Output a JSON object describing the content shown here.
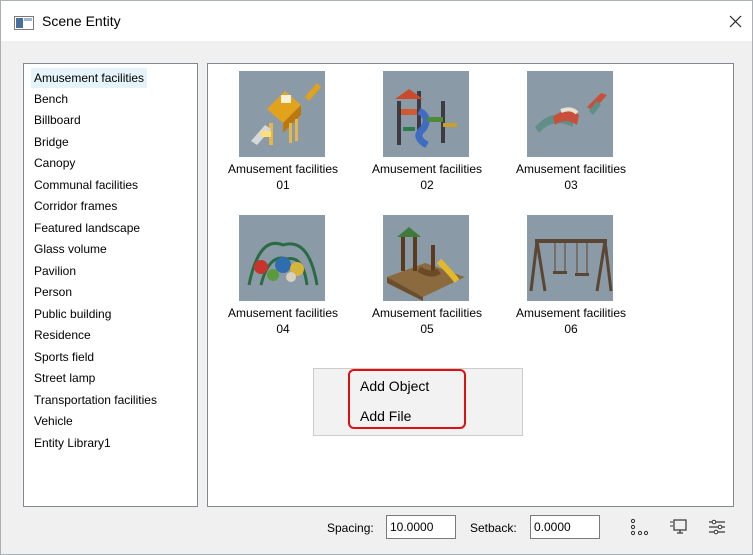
{
  "window": {
    "title": "Scene Entity",
    "close_icon": "close-icon",
    "app_icon": "window-icon"
  },
  "categories": [
    "Amusement facilities",
    "Bench",
    "Billboard",
    "Bridge",
    "Canopy",
    "Communal facilities",
    "Corridor frames",
    "Featured landscape",
    "Glass volume",
    "Pavilion",
    "Person",
    "Public building",
    "Residence",
    "Sports field",
    "Street lamp",
    "Transportation facilities",
    "Vehicle",
    "Entity Library1"
  ],
  "selected_category": "Amusement facilities",
  "items": [
    {
      "line1": "Amusement facilities",
      "line2": "01"
    },
    {
      "line1": "Amusement facilities",
      "line2": "02"
    },
    {
      "line1": "Amusement facilities",
      "line2": "03"
    },
    {
      "line1": "Amusement facilities",
      "line2": "04"
    },
    {
      "line1": "Amusement facilities",
      "line2": "05"
    },
    {
      "line1": "Amusement facilities",
      "line2": "06"
    }
  ],
  "context_menu": {
    "add_object": "Add Object",
    "add_file": "Add File"
  },
  "footer": {
    "spacing_label": "Spacing:",
    "spacing_value": "10.0000",
    "setback_label": "Setback:",
    "setback_value": "0.0000"
  },
  "colors": {
    "highlight_border": "#e01010",
    "selection_background": "#e5f3fb",
    "thumbnail_background": "#8a9ba7"
  }
}
